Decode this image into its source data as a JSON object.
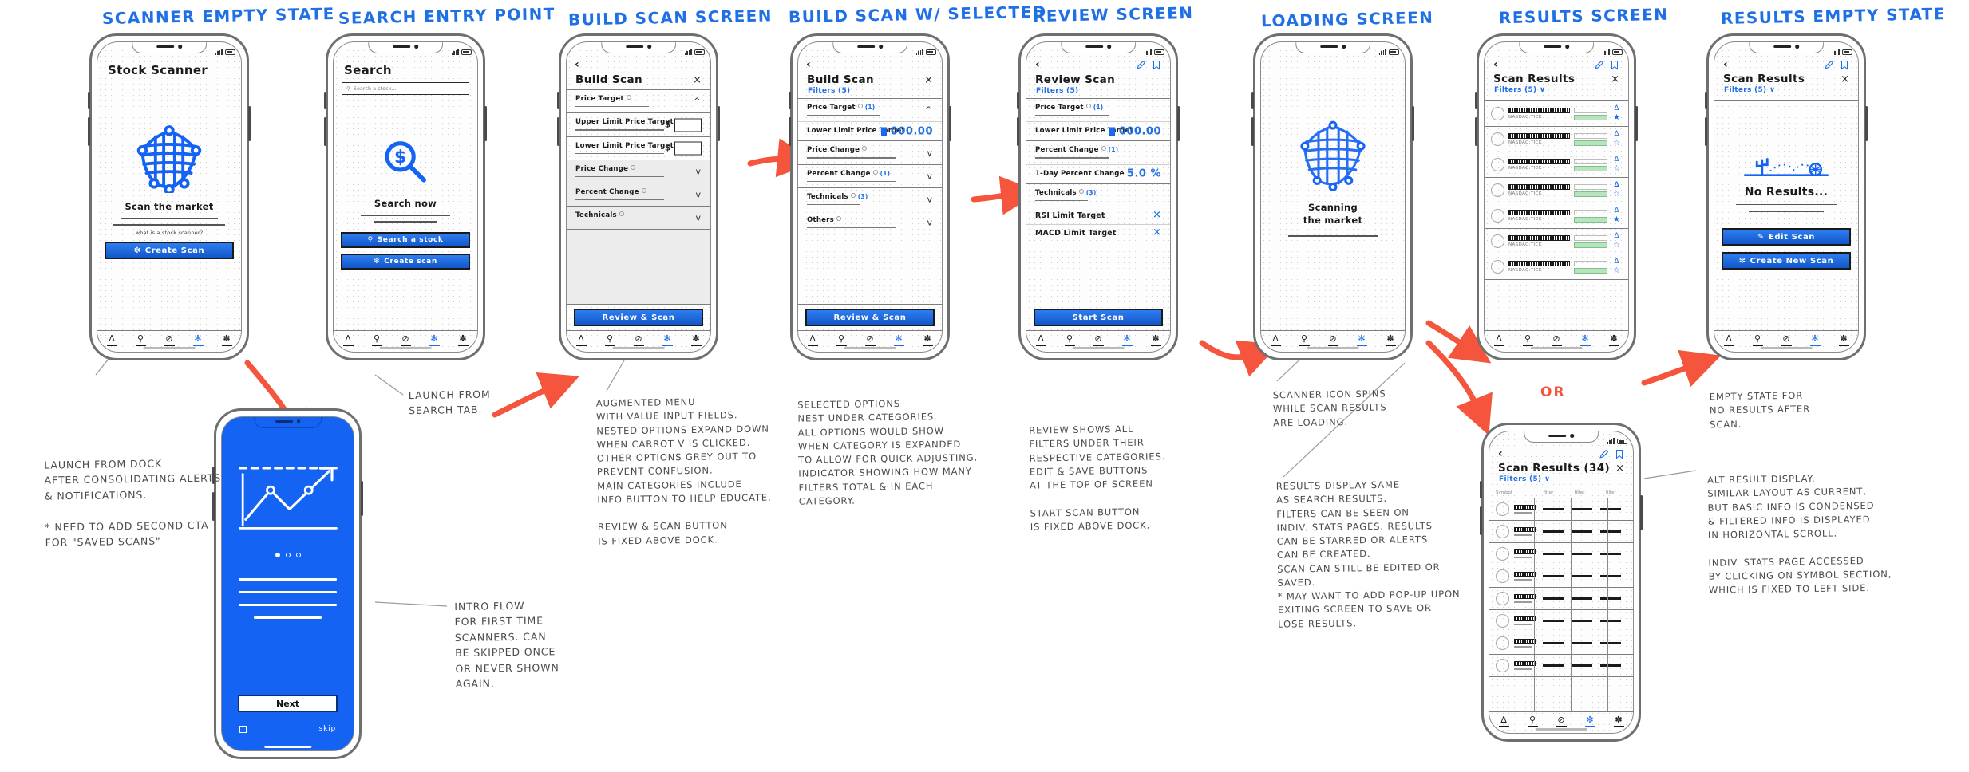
{
  "meta": {
    "accent": "#1f6fe5",
    "arrow_color": "#f4553c",
    "green": "#b9e3bf"
  },
  "flow_headers": [
    {
      "id": "h1",
      "label": "SCANNER EMPTY STATE"
    },
    {
      "id": "h2",
      "label": "SEARCH ENTRY POINT"
    },
    {
      "id": "h3",
      "label": "BUILD SCAN SCREEN"
    },
    {
      "id": "h4",
      "label": "BUILD SCAN W/ SELECTED"
    },
    {
      "id": "h5",
      "label": "REVIEW SCREEN"
    },
    {
      "id": "h6",
      "label": "LOADING SCREEN"
    },
    {
      "id": "h7",
      "label": "RESULTS SCREEN"
    },
    {
      "id": "h8",
      "label": "RESULTS EMPTY STATE"
    }
  ],
  "or_label": "OR",
  "dock": {
    "items": [
      {
        "name": "alerts",
        "glyph": "∆",
        "active": false
      },
      {
        "name": "search",
        "glyph": "⚲",
        "active": false
      },
      {
        "name": "watchlist",
        "glyph": "⊘",
        "active": false
      },
      {
        "name": "scanner",
        "glyph": "✻",
        "active": true
      },
      {
        "name": "settings",
        "glyph": "✽",
        "active": false
      }
    ]
  },
  "screen1": {
    "title": "Stock Scanner",
    "icon": "scanner-net-icon",
    "headline": "Scan the market",
    "subtext": "what is a stock scanner?",
    "cta": {
      "label": "Create Scan",
      "icon": "scanner-asterisk-icon"
    }
  },
  "screen2": {
    "title": "Search",
    "search_placeholder": "Search a stock...",
    "icon": "dollar-magnifier-icon",
    "headline": "Search now",
    "cta_primary": {
      "label": "Search a stock",
      "icon": "magnifier-icon"
    },
    "cta_secondary": {
      "label": "Create scan",
      "icon": "scanner-asterisk-icon"
    }
  },
  "screen3": {
    "back": "‹",
    "title": "Build Scan",
    "close": "×",
    "rows": [
      {
        "label": "Price Target",
        "info": true,
        "count": "",
        "chev": "^",
        "grey": false,
        "type": "category"
      },
      {
        "label": "Upper Limit Price Target",
        "type": "input",
        "currency": "$",
        "value": ""
      },
      {
        "label": "Lower Limit Price Target",
        "type": "input",
        "currency": "$",
        "value": ""
      },
      {
        "label": "Price Change",
        "info": true,
        "count": "",
        "chev": "v",
        "grey": true,
        "type": "category"
      },
      {
        "label": "Percent Change",
        "info": true,
        "count": "",
        "chev": "v",
        "grey": true,
        "type": "category"
      },
      {
        "label": "Technicals",
        "info": true,
        "count": "",
        "chev": "v",
        "grey": true,
        "type": "category"
      }
    ],
    "cta": {
      "label": "Review & Scan"
    }
  },
  "screen4": {
    "back": "‹",
    "title": "Build Scan",
    "close": "×",
    "filters_label": "Filters (5)",
    "rows": [
      {
        "label": "Price Target",
        "info": true,
        "count": "(1)",
        "chev": "^",
        "type": "category"
      },
      {
        "label": "Lower Limit Price Target",
        "type": "value",
        "currency": "$",
        "value": "000.00"
      },
      {
        "label": "Price Change",
        "info": true,
        "count": "",
        "chev": "v",
        "type": "category"
      },
      {
        "label": "Percent Change",
        "info": true,
        "count": "(1)",
        "chev": "v",
        "type": "category"
      },
      {
        "label": "Technicals",
        "info": true,
        "count": "(3)",
        "chev": "v",
        "type": "category"
      },
      {
        "label": "Others",
        "info": true,
        "count": "",
        "chev": "v",
        "type": "category"
      }
    ],
    "cta": {
      "label": "Review & Scan"
    }
  },
  "screen5": {
    "back": "‹",
    "title": "Review Scan",
    "filters_label": "Filters (5)",
    "edit_icon": "pencil-icon",
    "save_icon": "bookmark-icon",
    "rows": [
      {
        "label": "Price Target",
        "info": true,
        "count": "(1)",
        "type": "category"
      },
      {
        "label": "Lower Limit Price Target",
        "type": "value",
        "currency": "$",
        "value": "000.00"
      },
      {
        "label": "Percent Change",
        "info": true,
        "count": "(1)",
        "type": "category"
      },
      {
        "label": "1-Day Percent Change",
        "type": "value",
        "value": "5.0 %"
      },
      {
        "label": "Technicals",
        "info": true,
        "count": "(3)",
        "type": "category"
      },
      {
        "label": "RSI Limit Target",
        "type": "removable",
        "action": "✕"
      },
      {
        "label": "MACD Limit Target",
        "type": "removable",
        "action": "✕"
      }
    ],
    "cta": {
      "label": "Start Scan"
    }
  },
  "screen6": {
    "icon": "scanner-net-icon",
    "headline_line1": "Scanning",
    "headline_line2": "the market"
  },
  "screen7": {
    "back": "‹",
    "title": "Scan Results",
    "close": "×",
    "filters_label": "Filters (5) ∨",
    "edit_icon": "pencil-icon",
    "save_icon": "bookmark-icon",
    "rows": [
      {
        "ticker": "NASDAQ:TICK",
        "bell": "∆",
        "star": "★",
        "starred": true
      },
      {
        "ticker": "NASDAQ:TICK",
        "bell": "∆",
        "star": "☆",
        "starred": false
      },
      {
        "ticker": "NASDAQ:TICK",
        "bell": "∆",
        "star": "☆",
        "starred": false
      },
      {
        "ticker": "NASDAQ:TICK",
        "bell": "∆",
        "star": "☆",
        "starred": false
      },
      {
        "ticker": "NASDAQ:TICK",
        "bell": "∆",
        "star": "★",
        "starred": true
      },
      {
        "ticker": "NASDAQ:TICK",
        "bell": "∆",
        "star": "☆",
        "starred": false
      },
      {
        "ticker": "NASDAQ:TICK",
        "bell": "∆",
        "star": "☆",
        "starred": false
      }
    ]
  },
  "screen8": {
    "back": "‹",
    "title": "Scan Results",
    "close": "×",
    "filters_label": "Filters (5) ∨",
    "edit_icon": "pencil-icon",
    "save_icon": "bookmark-icon",
    "empty_icon": "desert-cactus-tumbleweed-icon",
    "empty_headline": "No Results...",
    "cta_primary": {
      "label": "Edit Scan",
      "icon": "pencil-icon"
    },
    "cta_secondary": {
      "label": "Create New Scan",
      "icon": "scanner-asterisk-icon"
    }
  },
  "screen9": {
    "back": "‹",
    "title": "Scan Results (34)",
    "close": "×",
    "filters_label": "Filters (5) ∨",
    "edit_icon": "pencil-icon",
    "save_icon": "bookmark-icon",
    "columns": [
      "Symbol",
      "filter",
      "filter",
      "filter"
    ],
    "row_count": 8
  },
  "intro": {
    "icon": "growth-chart-icon",
    "next_label": "Next",
    "skip_label": "skip",
    "dots": 3,
    "active_dot": 0
  },
  "annotations": [
    {
      "id": "a1",
      "text": "LAUNCH FROM DOCK\nAFTER CONSOLIDATING ALERTS\n& NOTIFICATIONS.\n\n* NEED TO ADD SECOND CTA\nFOR \"SAVED SCANS\""
    },
    {
      "id": "a2",
      "text": "LAUNCH FROM\nSEARCH TAB."
    },
    {
      "id": "a3",
      "text": "INTRO FLOW\nFOR FIRST TIME\nSCANNERS. CAN\nBE SKIPPED ONCE\nOR NEVER SHOWN\nAGAIN."
    },
    {
      "id": "a4",
      "text": "AUGMENTED MENU\nWITH VALUE INPUT FIELDS.\nNESTED OPTIONS EXPAND DOWN\nWHEN CARROT V IS CLICKED.\nOTHER OPTIONS GREY OUT TO\nPREVENT CONFUSION.\nMAIN CATEGORIES INCLUDE\nINFO BUTTON TO HELP EDUCATE.\n\nREVIEW & SCAN BUTTON\nIS FIXED ABOVE DOCK."
    },
    {
      "id": "a5",
      "text": "SELECTED OPTIONS\nNEST UNDER CATEGORIES.\nALL OPTIONS WOULD SHOW\nWHEN CATEGORY IS EXPANDED\nTO ALLOW FOR QUICK ADJUSTING.\nINDICATOR SHOWING HOW MANY\nFILTERS TOTAL & IN EACH\nCATEGORY."
    },
    {
      "id": "a6",
      "text": "REVIEW SHOWS ALL\nFILTERS UNDER THEIR\nRESPECTIVE CATEGORIES.\nEDIT & SAVE BUTTONS\nAT THE TOP OF SCREEN\n\nSTART SCAN BUTTON\nIS FIXED ABOVE DOCK."
    },
    {
      "id": "a7",
      "text": "SCANNER ICON SPINS\nWHILE SCAN RESULTS\nARE LOADING."
    },
    {
      "id": "a8",
      "text": "RESULTS DISPLAY SAME\nAS SEARCH RESULTS.\nFILTERS CAN BE SEEN ON\nINDIV. STATS PAGES. RESULTS\nCAN BE STARRED OR ALERTS\nCAN BE CREATED.\nSCAN CAN STILL BE EDITED OR\nSAVED.\n* MAY WANT TO ADD POP-UP UPON\n   EXITING SCREEN TO SAVE OR\n   LOSE RESULTS."
    },
    {
      "id": "a9",
      "text": "EMPTY STATE FOR\nNO RESULTS AFTER\nSCAN."
    },
    {
      "id": "a10",
      "text": "ALT RESULT DISPLAY.\nSIMILAR LAYOUT AS CURRENT,\nBUT BASIC INFO IS CONDENSED\n& FILTERED INFO IS DISPLAYED\nIN HORIZONTAL SCROLL.\n\nINDIV. STATS PAGE ACCESSED\nBY CLICKING ON SYMBOL SECTION,\nWHICH IS FIXED TO LEFT SIDE."
    }
  ]
}
